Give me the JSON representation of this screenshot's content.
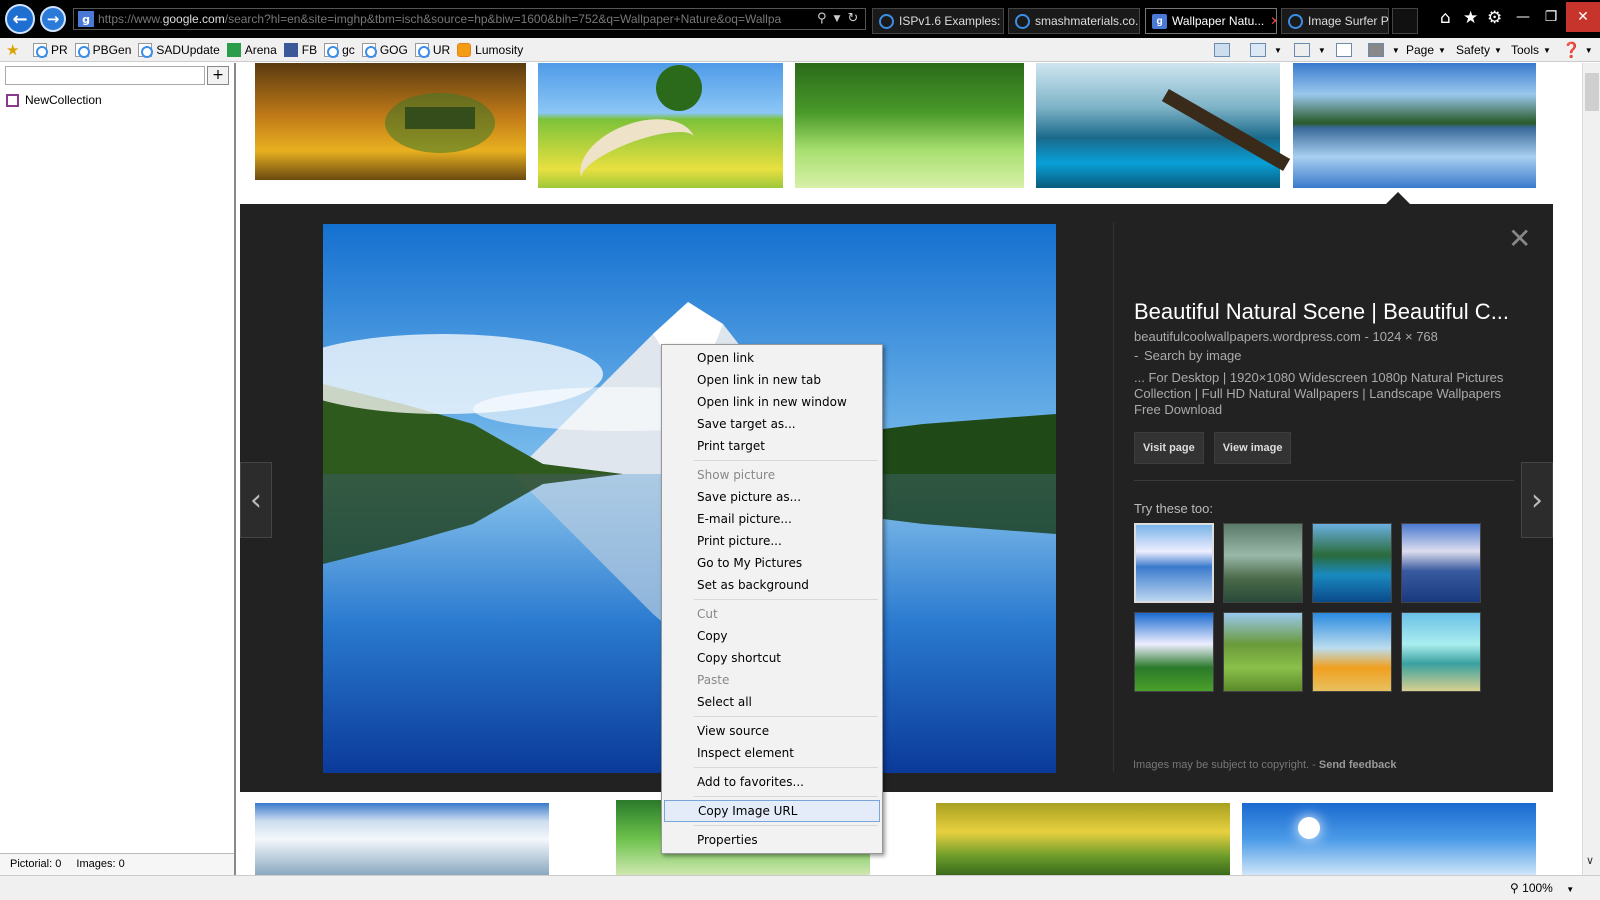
{
  "browser": {
    "address": {
      "url_prefix": "https://www.",
      "url_host": "google.com",
      "url_rest": "/search?hl=en&site=imghp&tbm=isch&source=hp&biw=1600&bih=752&q=Wallpaper+Nature&oq=Wallpa"
    },
    "tabs": [
      {
        "title": "ISPv1.6 Examples: ...",
        "icon": "ie-icon",
        "active": false
      },
      {
        "title": "smashmaterials.co...",
        "icon": "ie-icon",
        "active": false
      },
      {
        "title": "Wallpaper Natu...",
        "icon": "google-icon",
        "active": true
      },
      {
        "title": "Image Surfer Pro G...",
        "icon": "ie-icon",
        "active": false
      }
    ],
    "favorites": [
      {
        "label": "PR",
        "icon": "page-icon"
      },
      {
        "label": "PBGen",
        "icon": "page-icon"
      },
      {
        "label": "SADUpdate",
        "icon": "page-icon"
      },
      {
        "label": "Arena",
        "icon": "grid-icon"
      },
      {
        "label": "FB",
        "icon": "facebook-icon"
      },
      {
        "label": "gc",
        "icon": "page-icon"
      },
      {
        "label": "GOG",
        "icon": "page-icon"
      },
      {
        "label": "UR",
        "icon": "page-icon"
      },
      {
        "label": "Lumosity",
        "icon": "lumosity-icon"
      }
    ],
    "commands": {
      "page": "Page",
      "safety": "Safety",
      "tools": "Tools"
    },
    "zoom": "100%"
  },
  "sidebar": {
    "add_button": "+",
    "collection": "NewCollection",
    "status_pictorial": "Pictorial: 0",
    "status_images": "Images: 0"
  },
  "preview": {
    "title": "Beautiful Natural Scene | Beautiful C...",
    "source": "beautifulcoolwallpapers.wordpress.com",
    "dimensions": "1024 × 768",
    "search_by_image": "Search by image",
    "description": "... For Desktop | 1920×1080 Widescreen 1080p Natural Pictures Collection | Full HD Natural Wallpapers | Landscape Wallpapers Free Download",
    "visit_page": "Visit page",
    "view_image": "View image",
    "try_these": "Try these too:",
    "copyright": "Images may be subject to copyright.",
    "send_feedback": "Send feedback"
  },
  "context_menu": {
    "groups": [
      [
        {
          "label": "Open link",
          "disabled": false
        },
        {
          "label": "Open link in new tab",
          "disabled": false
        },
        {
          "label": "Open link in new window",
          "disabled": false
        },
        {
          "label": "Save target as...",
          "disabled": false
        },
        {
          "label": "Print target",
          "disabled": false
        }
      ],
      [
        {
          "label": "Show picture",
          "disabled": true
        },
        {
          "label": "Save picture as...",
          "disabled": false
        },
        {
          "label": "E-mail picture...",
          "disabled": false
        },
        {
          "label": "Print picture...",
          "disabled": false
        },
        {
          "label": "Go to My Pictures",
          "disabled": false
        },
        {
          "label": "Set as background",
          "disabled": false
        }
      ],
      [
        {
          "label": "Cut",
          "disabled": true
        },
        {
          "label": "Copy",
          "disabled": false
        },
        {
          "label": "Copy shortcut",
          "disabled": false
        },
        {
          "label": "Paste",
          "disabled": true
        },
        {
          "label": "Select all",
          "disabled": false
        }
      ],
      [
        {
          "label": "View source",
          "disabled": false
        },
        {
          "label": "Inspect element",
          "disabled": false
        }
      ],
      [
        {
          "label": "Add to favorites...",
          "disabled": false
        }
      ],
      [
        {
          "label": "Copy Image URL",
          "disabled": false,
          "highlighted": true
        }
      ],
      [
        {
          "label": "Properties",
          "disabled": false
        }
      ]
    ]
  },
  "colors": {
    "titlebar": "#000000",
    "panel_bg": "#222222",
    "menu_highlight": "#e3ecf8",
    "back_button": "#1e6fd0",
    "close_button": "#c7342b"
  }
}
